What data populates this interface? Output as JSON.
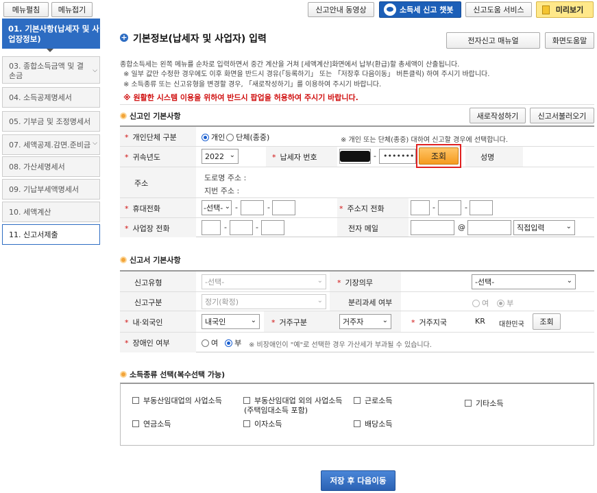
{
  "top_left": {
    "edit_menu": "메뉴펼침",
    "collapse_menu": "메뉴접기"
  },
  "top_right": {
    "guide_video": "신고안내 동영상",
    "chatbot": "소득세 신고 챗봇",
    "help_service": "신고도움 서비스",
    "preview": "미리보기"
  },
  "sidebar": {
    "items": [
      {
        "label": "01. 기본사항(납세자 및 사업장정보)"
      },
      {
        "label": "03. 종합소득금액 및 결손금"
      },
      {
        "label": "04. 소득공제명세서"
      },
      {
        "label": "05. 기부금 및 조정명세서"
      },
      {
        "label": "07. 세액공제.감면.준비금"
      },
      {
        "label": "08. 가산세명세서"
      },
      {
        "label": "09. 기납부세액명세서"
      },
      {
        "label": "10. 세액계산"
      },
      {
        "label": "11. 신고서제출"
      }
    ]
  },
  "header": {
    "title": "기본정보(납세자 및 사업자) 입력",
    "manual_button": "전자신고 매뉴얼",
    "help_button": "화면도움말"
  },
  "notice": {
    "line1": "종합소득세는 왼쪽 메뉴를 순차로 입력하면서 중간 계산을 거쳐 [세액계산]화면에서 납부(환급)할 총세액이 산출됩니다.",
    "line2": "※ 일부 값만 수정한 경우에도 이후 화면을 반드시 경유(「등록하기」 또는 「저장후 다음이동」 버튼클릭) 하여 주시기 바랍니다.",
    "line3": "※ 소득종류 또는 신고유형을 변경할 경우, 「새로작성하기」를 이용하여 주시기 바랍니다.",
    "warning": "※ 원활한 시스템 이용을 위하여 반드시 팝업을 허용하여 주시기 바랍니다."
  },
  "section1": {
    "title": "신고인 기본사항",
    "new_button": "새로작성하기",
    "load_button": "신고서불러오기",
    "person_type_label": "개인단체 구분",
    "person_option": "개인",
    "group_option": "단체(종중)",
    "person_note": "※ 개인 또는 단체(종중) 대하여 신고할 경우에 선택합니다.",
    "year_label": "귀속년도",
    "year_value": "2022",
    "taxpayer_no_label": "납세자 번호",
    "taxpayer_no_masked": "•••••••",
    "lookup_button": "조회",
    "name_label": "성명",
    "address_label": "주소",
    "road_address": "도로명 주소 :",
    "lot_address": "지번 주소 :",
    "mobile_label": "휴대전화",
    "mobile_select": "-선택-",
    "home_phone_label": "주소지 전화",
    "business_phone_label": "사업장 전화",
    "email_label": "전자 메일",
    "email_at": "@",
    "email_domain_select": "직접입력",
    "dash": "-"
  },
  "section2": {
    "title": "신고서 기본사항",
    "report_type_label": "신고유형",
    "report_type_value": "-선택-",
    "bookkeeping_label": "기장의무",
    "bookkeeping_value": "-선택-",
    "report_class_label": "신고구분",
    "report_class_value": "정기(확정)",
    "separate_tax_label": "분리과세 여부",
    "yes": "여",
    "no": "부",
    "nationality_label": "내·외국인",
    "nationality_value": "내국인",
    "residence_label": "거주구분",
    "residence_value": "거주자",
    "residence_country_label": "거주지국",
    "country_code": "KR",
    "country_name": "대한민국",
    "country_lookup": "조회",
    "disabled_label": "장애인 여부",
    "disabled_note": "※ 비장애인이 \"예\"로 선택한 경우 가산세가 부과될 수 있습니다."
  },
  "section3": {
    "title": "소득종류 선택(복수선택 가능)",
    "options": [
      "부동산임대업의 사업소득",
      "부동산임대업 외의 사업소득",
      "(주택임대소득 포함)",
      "근로소득",
      "기타소득",
      "연금소득",
      "이자소득",
      "배당소득"
    ]
  },
  "footer": {
    "save_next": "저장 후 다음이동"
  }
}
